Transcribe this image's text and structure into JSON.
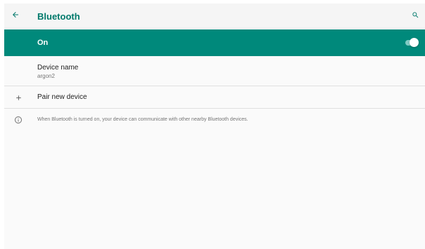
{
  "toolbar": {
    "title": "Bluetooth",
    "back_icon": "arrow-back-icon",
    "search_icon": "search-icon"
  },
  "master_switch": {
    "label": "On",
    "state": "on"
  },
  "device_name": {
    "title": "Device name",
    "value": "argon2"
  },
  "pair_new_device": {
    "icon": "plus-icon",
    "label": "Pair new device"
  },
  "footer": {
    "icon": "info-icon",
    "text": "When Bluetooth is turned on, your device can communicate with other nearby Bluetooth devices."
  },
  "colors": {
    "accent": "#00897b",
    "title": "#00796b",
    "toggle_track": "#80cbc4"
  }
}
